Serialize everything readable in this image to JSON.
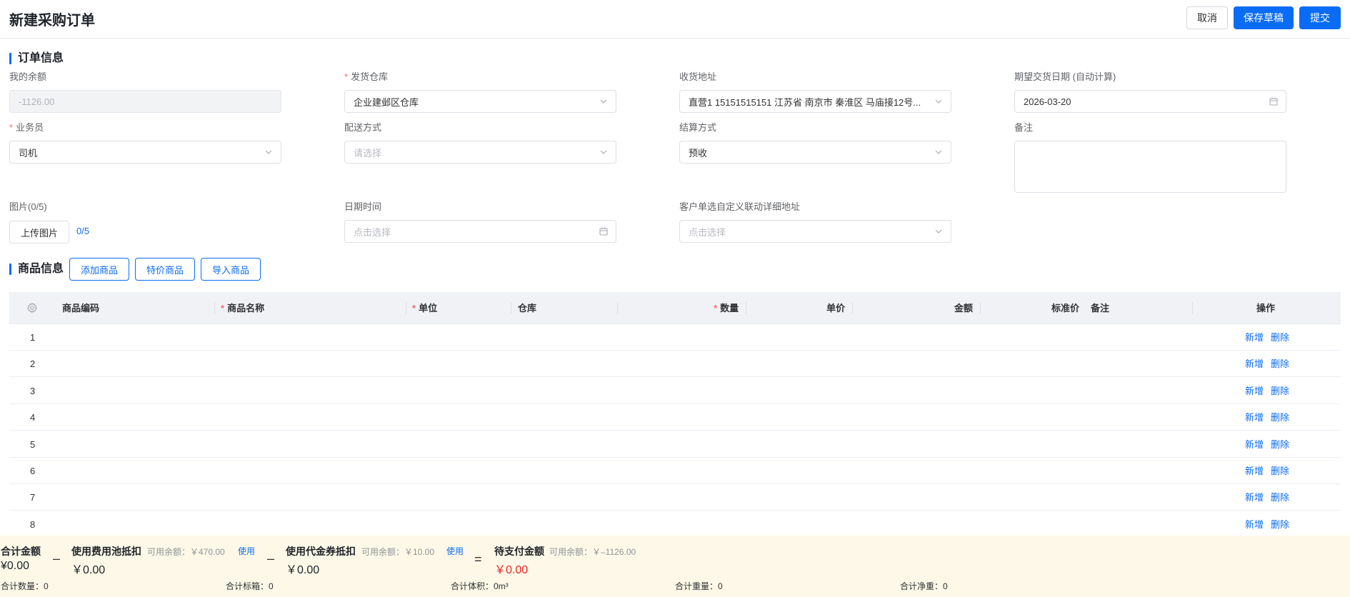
{
  "header": {
    "title": "新建采购订单",
    "cancel_label": "取消",
    "save_draft_label": "保存草稿",
    "submit_label": "提交"
  },
  "order_section": {
    "title": "订单信息",
    "balance": {
      "label": "我的余额",
      "value": "-1126.00"
    },
    "warehouse": {
      "label": "发货仓库",
      "value": "企业建邺区仓库"
    },
    "address": {
      "label": "收货地址",
      "value": "直营1 15151515151 江苏省 南京市 秦淮区 马庙接12号..."
    },
    "expected_date": {
      "label": "期望交货日期 (自动计算)",
      "value": "2026-03-20"
    },
    "salesperson": {
      "label": "业务员",
      "value": "司机"
    },
    "delivery": {
      "label": "配送方式",
      "placeholder": "请选择"
    },
    "settlement": {
      "label": "结算方式",
      "value": "预收"
    },
    "remark": {
      "label": "备注"
    },
    "images": {
      "label": "图片(0/5)",
      "upload_label": "上传图片",
      "count": "0/5"
    },
    "datetime": {
      "label": "日期时间",
      "placeholder": "点击选择"
    },
    "custom_address": {
      "label": "客户单选自定义联动详细地址",
      "placeholder": "点击选择"
    }
  },
  "goods_section": {
    "title": "商品信息",
    "buttons": {
      "add": "添加商品",
      "special": "特价商品",
      "import": "导入商品"
    },
    "columns": {
      "code": "商品编码",
      "name": "商品名称",
      "unit": "单位",
      "warehouse": "仓库",
      "quantity": "数量",
      "price": "单价",
      "amount": "金额",
      "std_price": "标准价",
      "remark": "备注",
      "action": "操作"
    },
    "rows": [
      "1",
      "2",
      "3",
      "4",
      "5",
      "6",
      "7",
      "8"
    ],
    "action_add": "新增",
    "action_delete": "删除"
  },
  "footer": {
    "total": {
      "label": "合计金额",
      "value": "¥0.00"
    },
    "minus": "–",
    "equals": "=",
    "fee_pool": {
      "label": "使用费用池抵扣",
      "hint": "可用余额：￥470.00",
      "use": "使用",
      "value": "￥0.00"
    },
    "voucher": {
      "label": "使用代金券抵扣",
      "hint": "可用余额：￥10.00",
      "use": "使用",
      "value": "￥0.00"
    },
    "to_pay": {
      "label": "待支付金额",
      "hint": "可用余额：￥–1126.00",
      "value": "￥0.00"
    },
    "stats": {
      "qty": "合计数量：0",
      "boxes": "合计标箱：0",
      "volume": "合计体积：0m³",
      "weight": "合计重量：0",
      "net": "合计净重：0"
    }
  },
  "colors": {
    "primary": "#0a6cf5",
    "required": "#f56c6c",
    "pay_red": "#f02424",
    "footer_bg": "#fdf8e7"
  }
}
